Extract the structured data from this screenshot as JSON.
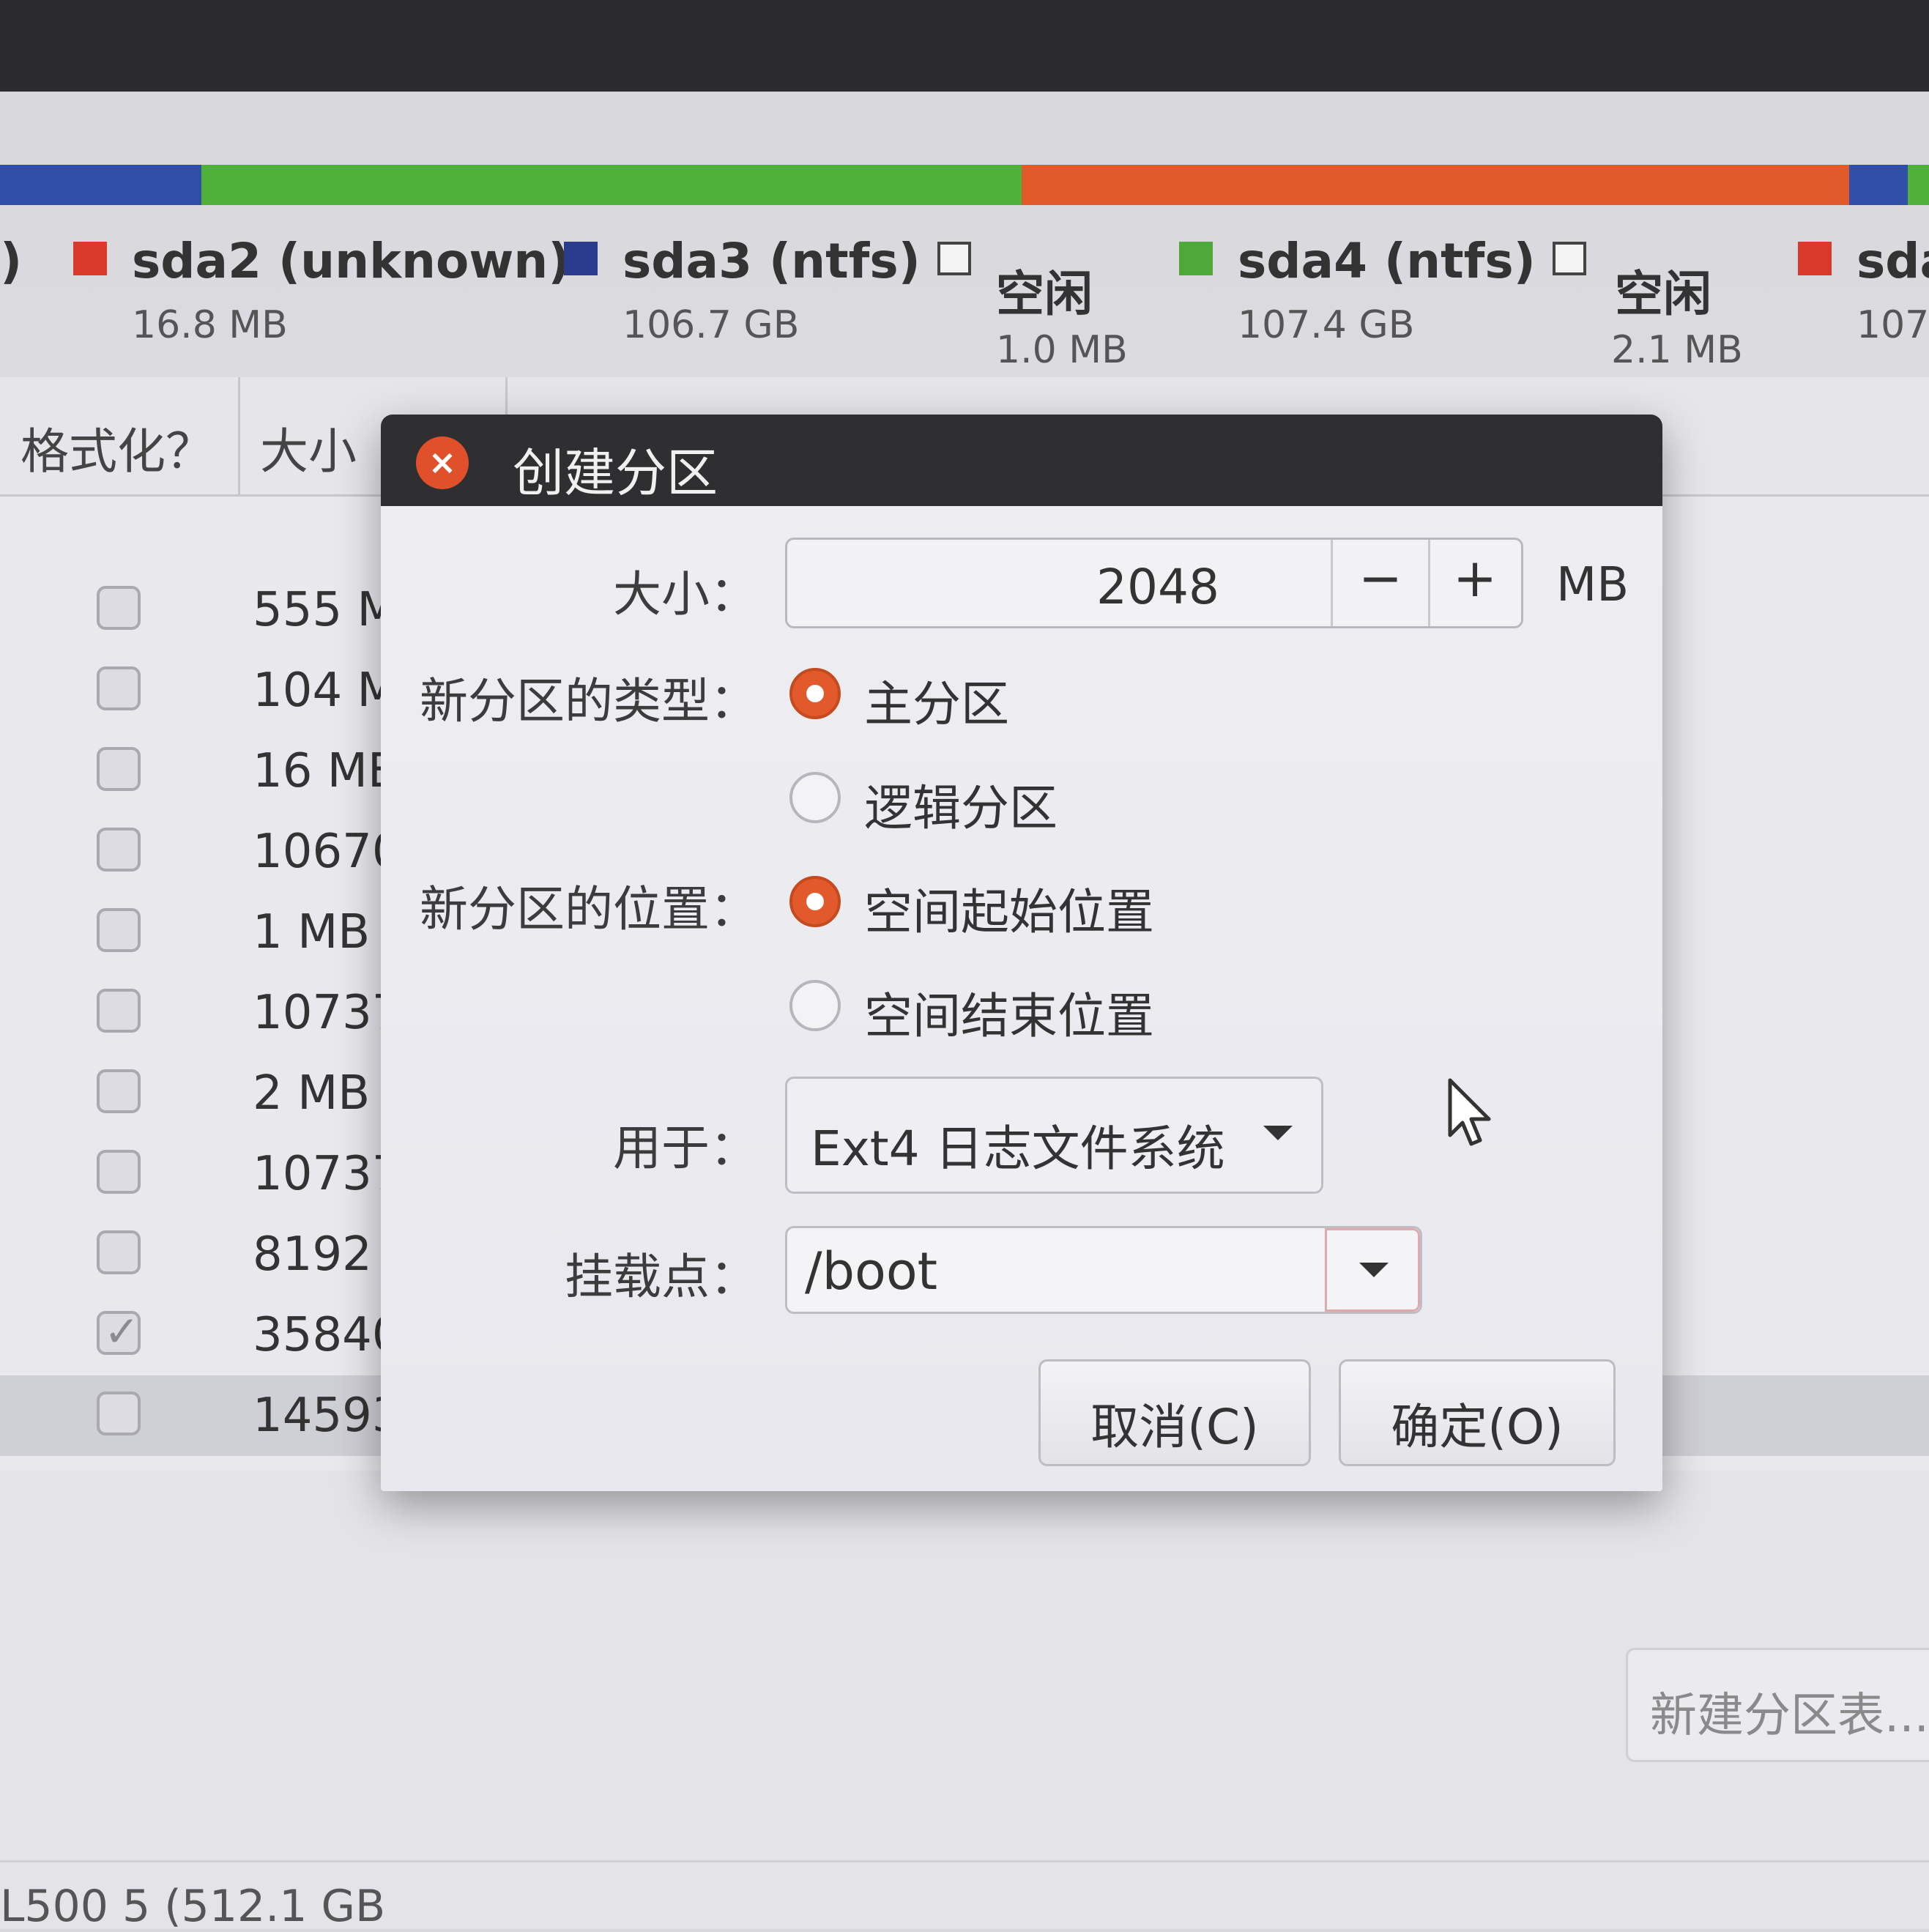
{
  "partition_bar": [
    {
      "color": "#2f4fa8",
      "weight": 275
    },
    {
      "color": "#4fb03a",
      "weight": 1120
    },
    {
      "color": "#e05a2a",
      "weight": 1130
    },
    {
      "color": "#2f4fa8",
      "weight": 80
    },
    {
      "color": "#4fb03a",
      "weight": 29
    }
  ],
  "legend": [
    {
      "name": ")",
      "size": "",
      "color": "",
      "free": false
    },
    {
      "name": "sda2 (unknown)",
      "size": "16.8 MB",
      "color": "#d93a2a",
      "free": false
    },
    {
      "name": "sda3 (ntfs)",
      "size": "106.7 GB",
      "color": "#2c3c8c",
      "free": false
    },
    {
      "name": "空闲",
      "size": "1.0 MB",
      "color": "",
      "free": true
    },
    {
      "name": "sda4 (ntfs)",
      "size": "107.4 GB",
      "color": "#4fa83a",
      "free": false
    },
    {
      "name": "空闲",
      "size": "2.1 MB",
      "color": "",
      "free": true
    },
    {
      "name": "sda",
      "size": "107.",
      "color": "#d93a2a",
      "free": false
    }
  ],
  "table": {
    "headers": [
      "格式化？",
      "大小"
    ],
    "rows": [
      {
        "size": "555 M",
        "checked": false
      },
      {
        "size": "104 M",
        "checked": false
      },
      {
        "size": "16 ME",
        "checked": false
      },
      {
        "size": "10670",
        "checked": false
      },
      {
        "size": "1 MB",
        "checked": false
      },
      {
        "size": "10737",
        "checked": false
      },
      {
        "size": "2 MB",
        "checked": false
      },
      {
        "size": "10737",
        "checked": false
      },
      {
        "size": "8192 I",
        "checked": false
      },
      {
        "size": "35840",
        "checked": true
      },
      {
        "size": "14593",
        "checked": false
      }
    ]
  },
  "new_partition_table_button": "新建分区表...",
  "device_label": "L500 5 (512.1 GB",
  "dialog": {
    "title": "创建分区",
    "close_icon": "×",
    "size_label": "大小：",
    "size_value": "2048",
    "minus": "−",
    "plus": "+",
    "unit": "MB",
    "type_label": "新分区的类型：",
    "type_options": [
      {
        "label": "主分区",
        "selected": true
      },
      {
        "label": "逻辑分区",
        "selected": false
      }
    ],
    "position_label": "新分区的位置：",
    "position_options": [
      {
        "label": "空间起始位置",
        "selected": true
      },
      {
        "label": "空间结束位置",
        "selected": false
      }
    ],
    "use_as_label": "用于：",
    "use_as_value": "Ext4 日志文件系统",
    "mount_label": "挂载点：",
    "mount_value": "/boot",
    "cancel": "取消(C)",
    "ok": "确定(O)"
  }
}
